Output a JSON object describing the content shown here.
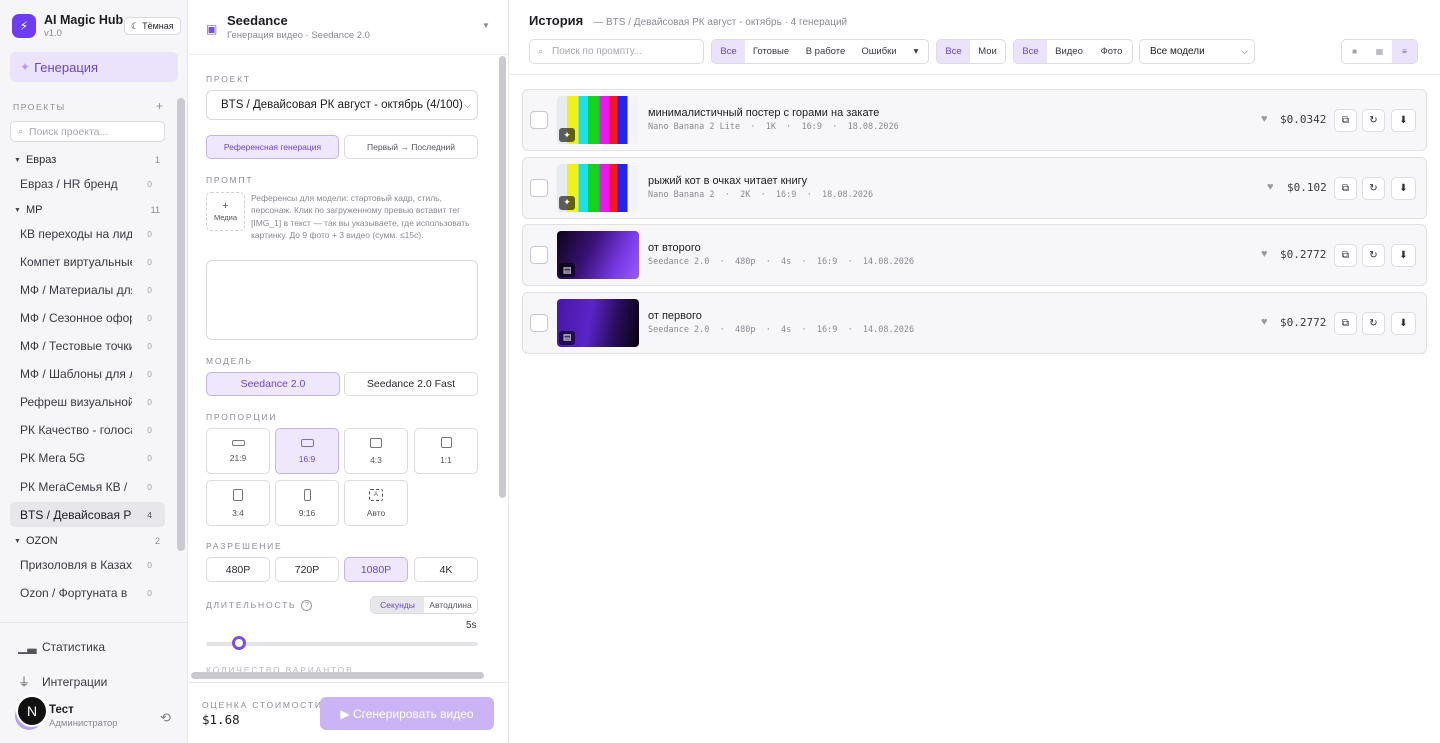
{
  "app": {
    "name": "AI Magic Hub",
    "version": "v1.0",
    "theme_label": "Тёмная",
    "logo": "bolt-icon"
  },
  "colors": {
    "accent": "#7b4ee6",
    "accent_soft": "#efe8fd",
    "primary_disabled": "#cbb4f5"
  },
  "sidebar": {
    "generation_label": "Генерация",
    "projects_heading": "ПРОЕКТЫ",
    "search_placeholder": "Поиск проекта...",
    "groups": [
      {
        "name": "Евраз",
        "count": "1",
        "items": [
          {
            "label": "Евраз / HR бренд",
            "count": "0"
          }
        ]
      },
      {
        "name": "МР",
        "count": "11",
        "items": [
          {
            "label": "КВ переходы на лидов",
            "count": "0"
          },
          {
            "label": "Компет виртуальные",
            "count": "0"
          },
          {
            "label": "МФ / Материалы для",
            "count": "0"
          },
          {
            "label": "МФ / Сезонное оформ",
            "count": "0"
          },
          {
            "label": "МФ / Тестовые точки",
            "count": "0"
          },
          {
            "label": "МФ / Шаблоны для ле",
            "count": "0"
          },
          {
            "label": "Рефреш визуальной к",
            "count": "0"
          },
          {
            "label": "РК Качество - голоса",
            "count": "0"
          },
          {
            "label": "РК Мега 5G",
            "count": "0"
          },
          {
            "label": "РК МегаСемья КВ / …",
            "count": "0"
          },
          {
            "label": "BTS / Девайсовая РК",
            "count": "4"
          }
        ]
      },
      {
        "name": "OZON",
        "count": "2",
        "items": [
          {
            "label": "Призоловля в Казахст",
            "count": "0"
          },
          {
            "label": "Ozon / Фортуната в …",
            "count": "0"
          }
        ]
      }
    ],
    "bottom": [
      {
        "label": "Статистика",
        "icon": "chart-icon"
      },
      {
        "label": "Интеграции",
        "icon": "plug-icon"
      }
    ],
    "user": {
      "name": "Тест",
      "role": "Администратор",
      "badge": "N"
    }
  },
  "config": {
    "title": "Seedance",
    "subtitle": "Генерация видео · Seedance 2.0",
    "project_label": "ПРОЕКТ",
    "project_value": "BTS / Девайсовая РК август - октябрь (4/100)",
    "modes": [
      "Референсная генерация",
      "Первый → Последний"
    ],
    "prompt_label": "ПРОМПТ",
    "media_label": "Медиа",
    "prompt_hint": "Референсы для модели: стартовый кадр, стиль, персонаж. Клик по загруженному превью вставит тег [IMG_1] в текст — так вы указываете, где использовать картинку. До 9 фото + 3 видео (сумм. ≤15с).",
    "model_label": "МОДЕЛЬ",
    "models": [
      "Seedance 2.0",
      "Seedance 2.0 Fast"
    ],
    "ratio_label": "ПРОПОРЦИИ",
    "ratios": [
      "21:9",
      "16:9",
      "4:3",
      "1:1",
      "3:4",
      "9:16",
      "Авто"
    ],
    "ratio_auto_icon": "A",
    "resolution_label": "РАЗРЕШЕНИЕ",
    "resolutions": [
      "480P",
      "720P",
      "1080P",
      "4K"
    ],
    "duration_label": "ДЛИТЕЛЬНОСТЬ",
    "duration_tabs": [
      "Секунды",
      "Автодлина"
    ],
    "duration_value": "5s",
    "duration_fraction": 0.1,
    "variants_label": "КОЛИЧЕСТВО ВАРИАНТОВ",
    "cost_label": "ОЦЕНКА СТОИМОСТИ",
    "cost_value": "$1.68",
    "generate_label": "▶ Сгенерировать видео"
  },
  "history": {
    "title": "История",
    "breadcrumb": "— BTS / Девайсовая РК август - октябрь · 4 генераций",
    "search_placeholder": "Поиск по промпту...",
    "status_tabs": [
      "Все",
      "Готовые",
      "В работе",
      "Ошибки"
    ],
    "status_more": "▾",
    "owner_tabs": [
      "Все",
      "Мои"
    ],
    "type_tabs": [
      "Все",
      "Видео",
      "Фото"
    ],
    "model_filter": "Все модели",
    "items": [
      {
        "title": "минималистичный постер с горами на закате",
        "meta": "Nano Banana 2 Lite  ·  1K  ·  16:9  ·  18.08.2026",
        "price": "$0.0342",
        "kind": "image"
      },
      {
        "title": "рыжий кот в очках читает книгу",
        "meta": "Nano Banana 2  ·  2K  ·  16:9  ·  18.08.2026",
        "price": "$0.102",
        "kind": "image"
      },
      {
        "title": "от второго",
        "meta": "Seedance 2.0  ·  480p  ·  4s  ·  16:9  ·  14.08.2026",
        "price": "$0.2772",
        "kind": "video"
      },
      {
        "title": "от первого",
        "meta": "Seedance 2.0  ·  480p  ·  4s  ·  16:9  ·  14.08.2026",
        "price": "$0.2772",
        "kind": "video"
      }
    ]
  }
}
